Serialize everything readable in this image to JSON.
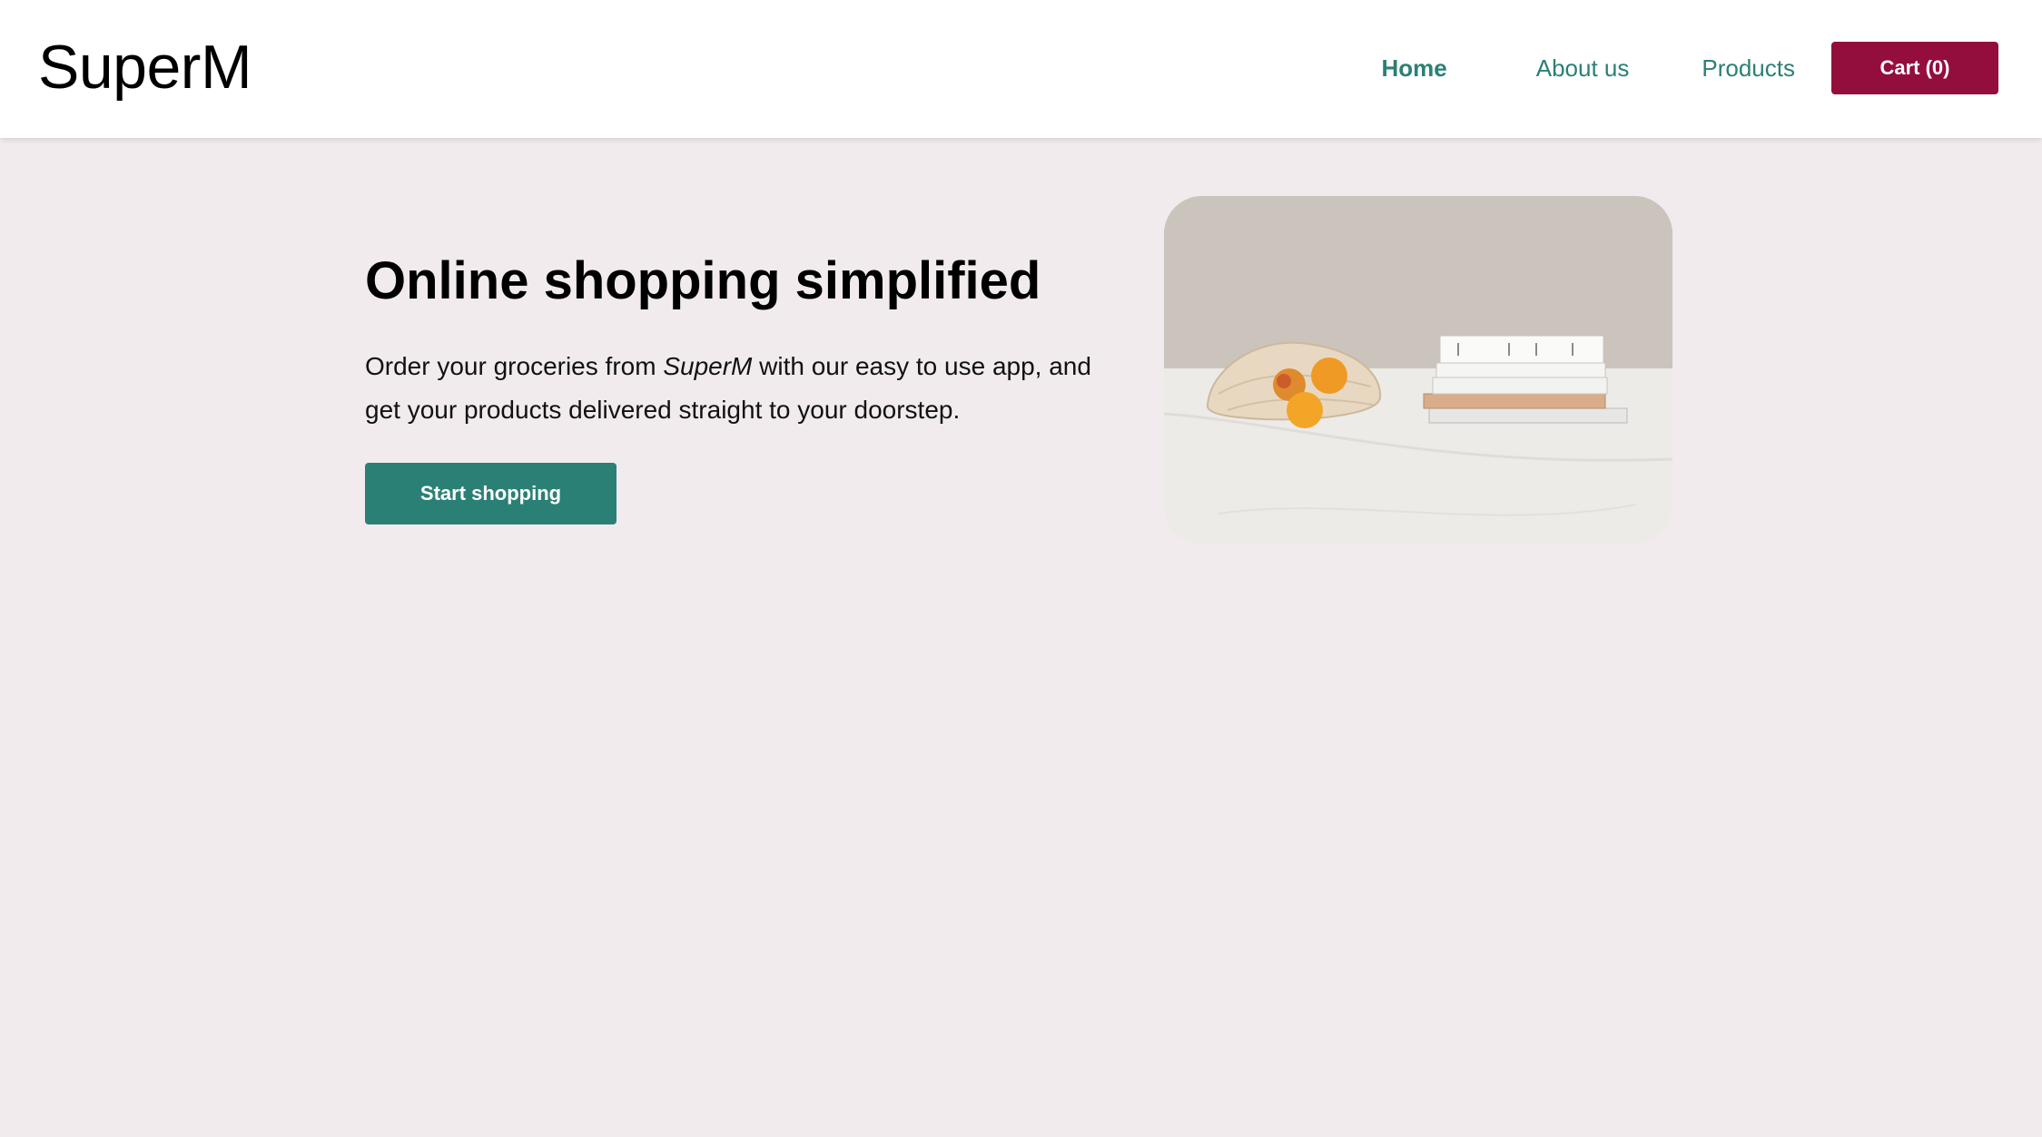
{
  "navbar": {
    "brand": "SuperM",
    "links": [
      {
        "label": "Home",
        "active": true
      },
      {
        "label": "About us",
        "active": false
      },
      {
        "label": "Products",
        "active": false
      }
    ],
    "cart_label": "Cart (0)"
  },
  "hero": {
    "title": "Online shopping simplified",
    "description_before": "Order your groceries from ",
    "description_brand": "SuperM",
    "description_after": " with our easy to use app, and get your products delivered straight to your doorstep.",
    "cta_label": "Start shopping",
    "image_alt": "Fruit in a mesh bag next to a stack of books on a marble table"
  },
  "colors": {
    "accent": "#2b8076",
    "cart": "#940e3d",
    "background": "#f1ebed",
    "navbar": "#ffffff"
  }
}
